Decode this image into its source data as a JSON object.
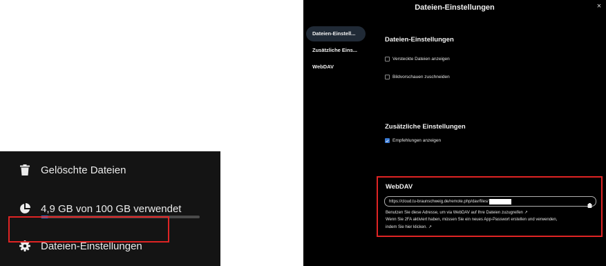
{
  "left_sidebar": {
    "trash_label": "Gelöschte Dateien",
    "quota_label": "4,9 GB von 100 GB verwendet",
    "quota_fraction": 0.049,
    "settings_label": "Dateien-Einstellungen"
  },
  "dialog": {
    "title": "Dateien-Einstellungen",
    "close_glyph": "×",
    "nav": [
      {
        "label": "Dateien-Einstell..."
      },
      {
        "label": "Zusätzliche Eins..."
      },
      {
        "label": "WebDAV"
      }
    ],
    "files_section": {
      "heading": "Dateien-Einstellungen",
      "options": [
        {
          "label": "Versteckte Dateien anzeigen",
          "checked": false
        },
        {
          "label": "Bildvorschauen zuschneiden",
          "checked": false
        }
      ]
    },
    "additional_section": {
      "heading": "Zusätzliche Einstellungen",
      "options": [
        {
          "label": "Empfehlungen anzeigen",
          "checked": true
        }
      ]
    },
    "webdav": {
      "heading": "WebDAV",
      "url": "https://cloud.tu-braunschweig.de/remote.php/dav/files/",
      "hint_1": "Benutzen Sie diese Adresse, um via WebDAV auf Ihre Dateien zuzugreifen",
      "hint_2": "Wenn Sie 2FA aktiviert haben, müssen Sie ein neues App-Passwort erstellen und verwenden,",
      "hint_3": "indem Sie hier klicken.",
      "external_glyph": "↗"
    }
  },
  "colors": {
    "accent": "#3a7bd5",
    "highlight": "#e02424",
    "sidebar_bg": "#141414",
    "dialog_bg": "#000000"
  },
  "icons": {
    "trash": "trash-icon",
    "quota": "pie-chart-icon",
    "settings": "gear-icon",
    "copy": "clipboard-icon"
  }
}
